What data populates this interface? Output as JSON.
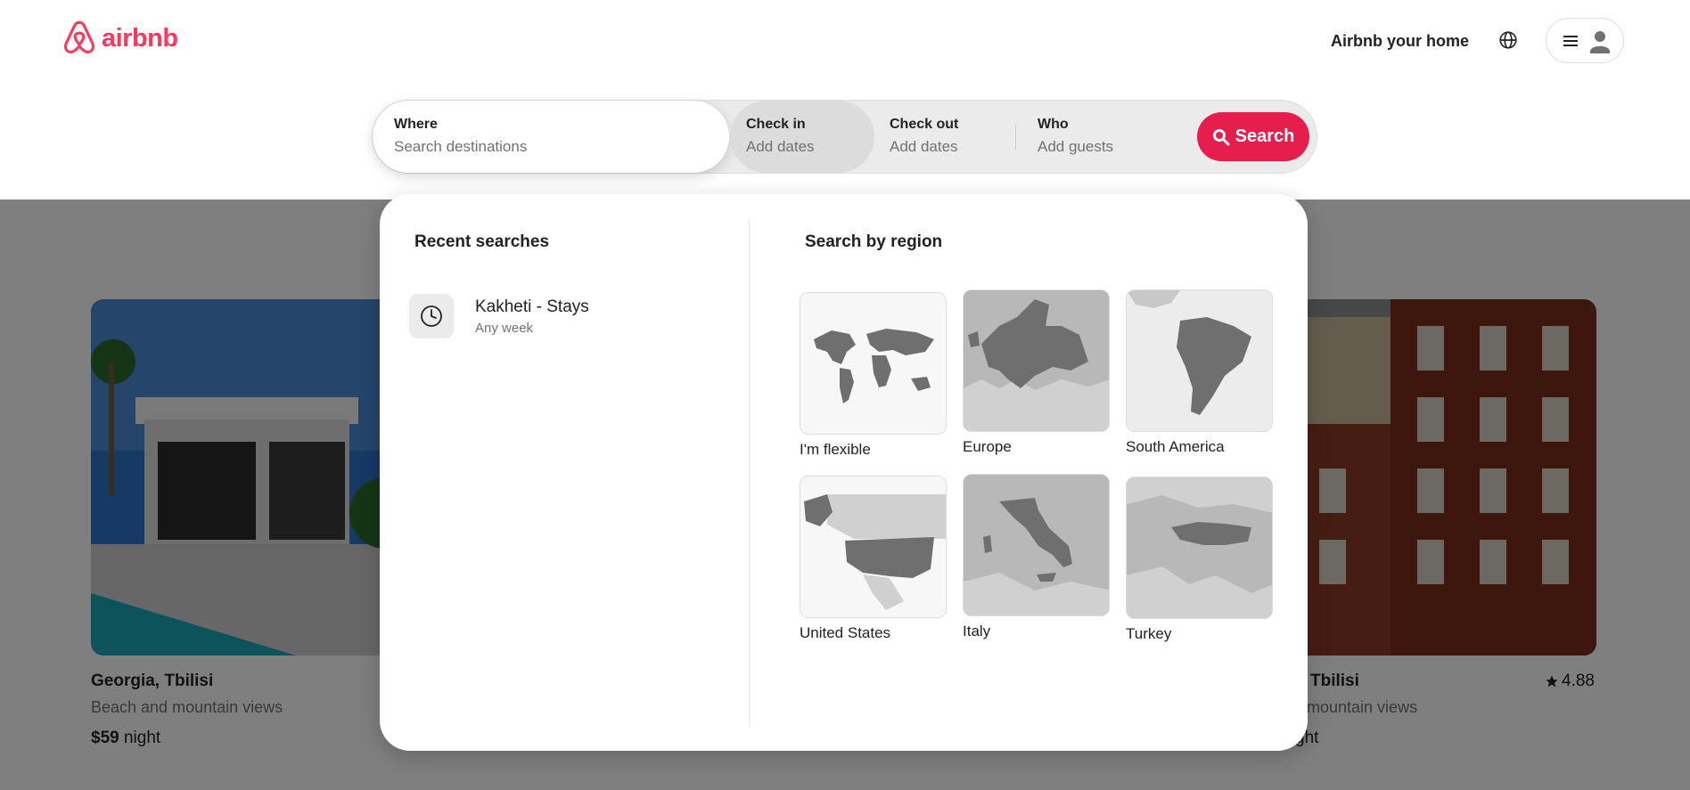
{
  "header": {
    "logo_text": "airbnb",
    "host_link": "Airbnb your home",
    "globe_icon": "globe-icon",
    "menu_icon": "hamburger-menu-icon",
    "avatar_icon": "user-avatar-icon"
  },
  "search": {
    "where_label": "Where",
    "where_placeholder": "Search destinations",
    "checkin_label": "Check in",
    "checkin_value": "Add dates",
    "checkout_label": "Check out",
    "checkout_value": "Add dates",
    "who_label": "Who",
    "who_value": "Add guests",
    "button_label": "Search",
    "button_icon": "search-icon"
  },
  "dropdown": {
    "recent_heading": "Recent searches",
    "recent": [
      {
        "title": "Kakheti - Stays",
        "subtitle": "Any week",
        "icon": "clock-icon"
      }
    ],
    "region_heading": "Search by region",
    "regions": [
      {
        "label": "I'm flexible"
      },
      {
        "label": "Europe"
      },
      {
        "label": "South America"
      },
      {
        "label": "United States"
      },
      {
        "label": "Italy"
      },
      {
        "label": "Turkey"
      }
    ]
  },
  "listings": {
    "left": {
      "title": "Georgia, Tbilisi",
      "subtitle": "Beach and mountain views",
      "price": "$59",
      "price_unit": "night"
    },
    "right": {
      "title_partial": "Tbilisi",
      "subtitle_partial": "d mountain views",
      "price_partial": "ght",
      "rating": "4.88"
    }
  },
  "colors": {
    "brand": "#ff385c",
    "search_button": "#e61e4d"
  }
}
